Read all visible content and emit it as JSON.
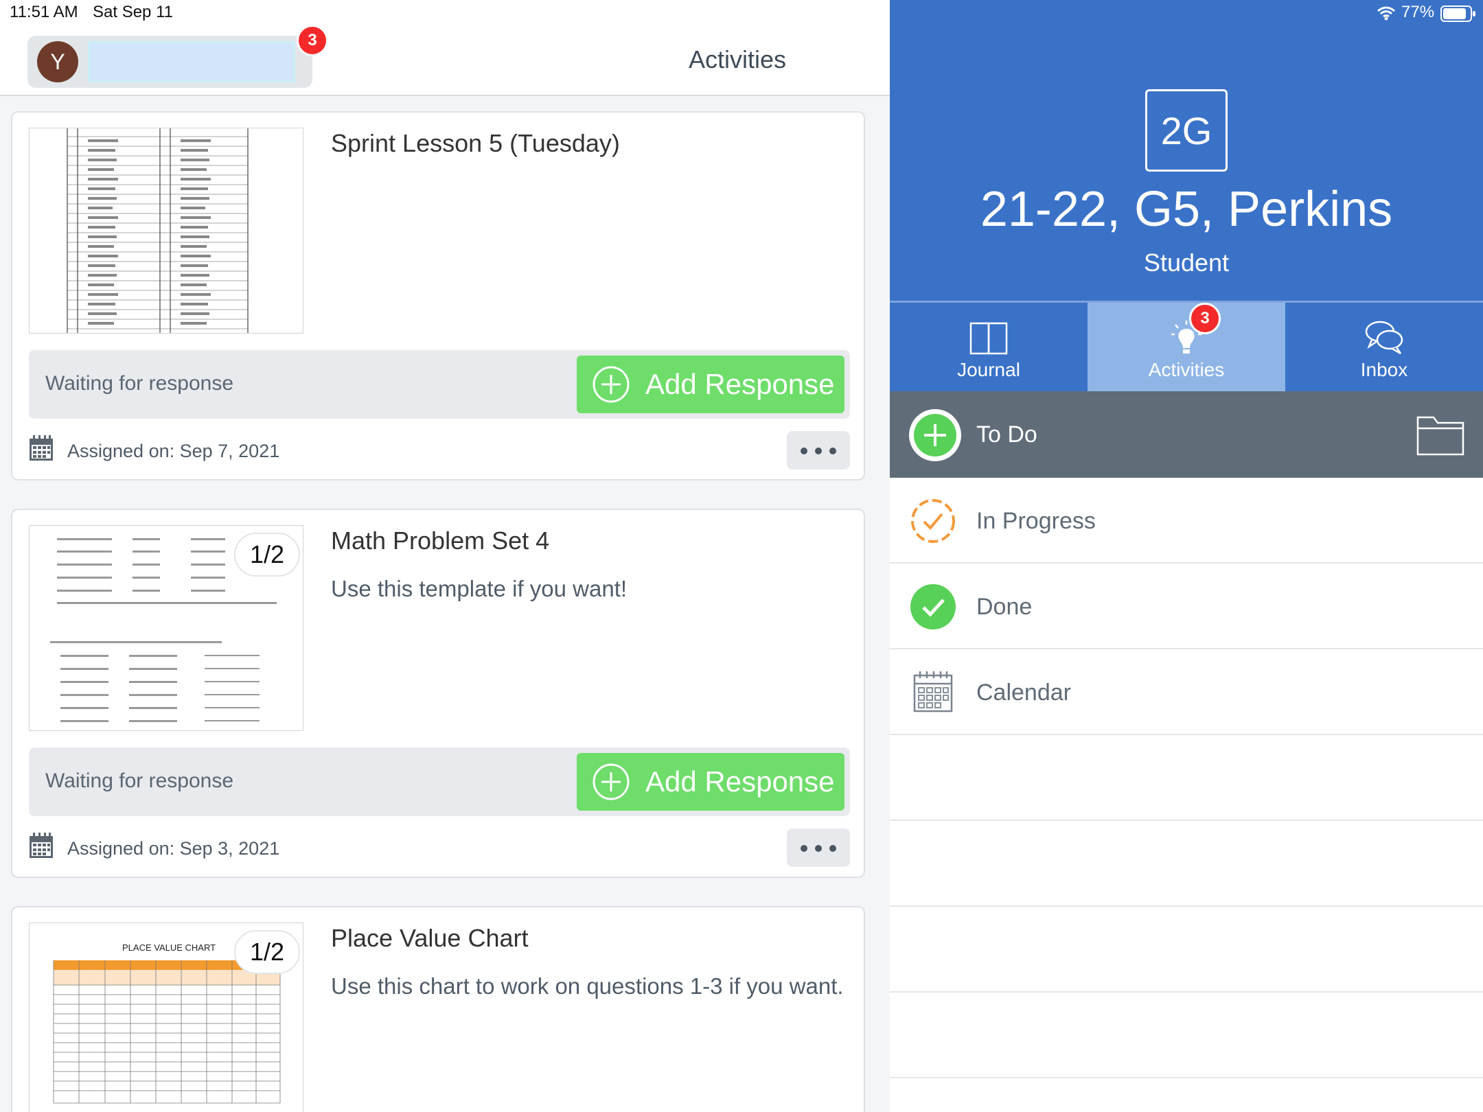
{
  "status": {
    "time": "11:51 AM",
    "date": "Sat Sep 11",
    "battery": "77%"
  },
  "left": {
    "avatar_initial": "Y",
    "notif_count": "3",
    "title": "Activities",
    "cards": [
      {
        "title": "Sprint Lesson 5 (Tuesday)",
        "subtitle": "",
        "page": "",
        "status": "Waiting for response",
        "button": "Add Response",
        "assigned": "Assigned on: Sep 7, 2021"
      },
      {
        "title": "Math Problem Set 4",
        "subtitle": "Use this template if you want!",
        "page": "1/2",
        "status": "Waiting for response",
        "button": "Add Response",
        "assigned": "Assigned on: Sep 3, 2021"
      },
      {
        "title": "Place Value Chart",
        "subtitle": "Use this chart to work on questions 1-3 if you want.",
        "page": "1/2",
        "thumb_title": "PLACE VALUE CHART"
      }
    ]
  },
  "right": {
    "class_code": "2G",
    "class_name": "21-22, G5, Perkins",
    "role": "Student",
    "tabs": [
      "Journal",
      "Activities",
      "Inbox"
    ],
    "active_tab": "Activities",
    "tab_badge": "3",
    "filters": [
      "To Do",
      "In Progress",
      "Done",
      "Calendar"
    ]
  },
  "colors": {
    "brand_blue": "#3a72c8",
    "active_tab": "#8fb5e7",
    "add_green": "#6edd6a",
    "badge_red": "#f42a2a",
    "progress_orange": "#f39a3c",
    "done_green": "#57d157"
  },
  "icons": [
    "wifi-icon",
    "battery-icon",
    "calendar-icon",
    "more-icon",
    "plus-circle-icon",
    "journal-icon",
    "lightbulb-icon",
    "inbox-icon",
    "folder-icon",
    "in-progress-icon",
    "done-check-icon"
  ]
}
